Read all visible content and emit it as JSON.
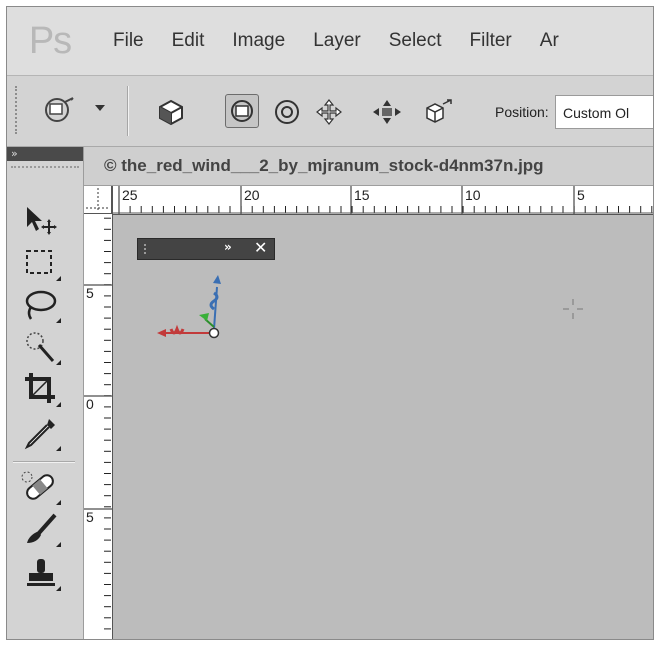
{
  "app": {
    "logo_text": "Ps"
  },
  "menu": {
    "items": [
      "File",
      "Edit",
      "Image",
      "Layer",
      "Select",
      "Filter",
      "Ar"
    ]
  },
  "options_bar": {
    "position_label": "Position:",
    "position_value": "Custom Ol"
  },
  "document": {
    "tab_title": "© the_red_wind___2_by_mjranum_stock-d4nm37n.jpg"
  },
  "ruler": {
    "horizontal_labels": [
      "25",
      "20",
      "15",
      "10",
      "5"
    ],
    "vertical_labels": [
      "5",
      "0",
      "5"
    ]
  },
  "axis_widget": {
    "expand_glyph": "»",
    "close_glyph": "✕"
  },
  "icons": {
    "tool_preset": "3d-rotate-icon",
    "tools": [
      "move-icon",
      "marquee-icon",
      "lasso-icon",
      "quick-select-icon",
      "crop-icon",
      "eyedropper-icon",
      "healing-brush-icon",
      "brush-icon",
      "clone-stamp-icon"
    ]
  }
}
